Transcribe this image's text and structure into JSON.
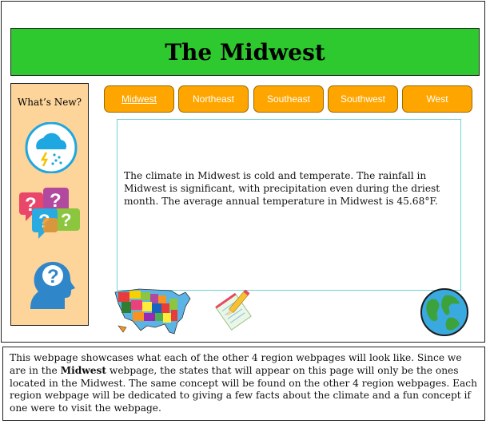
{
  "page": {
    "title": "The Midwest"
  },
  "sidebar": {
    "title": "What’s New?",
    "icons": [
      "weather-icon",
      "question-bubbles-icon",
      "head-question-icon"
    ]
  },
  "tabs": [
    {
      "label": "Midwest",
      "active": true
    },
    {
      "label": "Northeast",
      "active": false
    },
    {
      "label": "Southeast",
      "active": false
    },
    {
      "label": "Southwest",
      "active": false
    },
    {
      "label": "West",
      "active": false
    }
  ],
  "content": {
    "text": "The climate in Midwest is cold and temperate. The rainfall in Midwest is significant, with precipitation even during the driest month. The average annual temperature in Midwest is 45.68°F."
  },
  "footer": {
    "text_before": "This webpage showcases what each of the other 4 region webpages will look like. Since we are in the ",
    "bold": "Midwest",
    "text_after": " webpage, the states that will appear on this page will only be the ones located in the Midwest. The same concept will be found on the other 4 region webpages. Each region webpage will be dedicated to giving a few facts about the climate and a fun concept if one were to visit the webpage."
  },
  "colors": {
    "banner": "#2ec92e",
    "sidebar": "#fdd49a",
    "tab": "#ffa500",
    "content_border": "#6fd3d3"
  },
  "bottom_icons": [
    "us-map-icon",
    "notepad-pencil-icon",
    "globe-icon"
  ]
}
